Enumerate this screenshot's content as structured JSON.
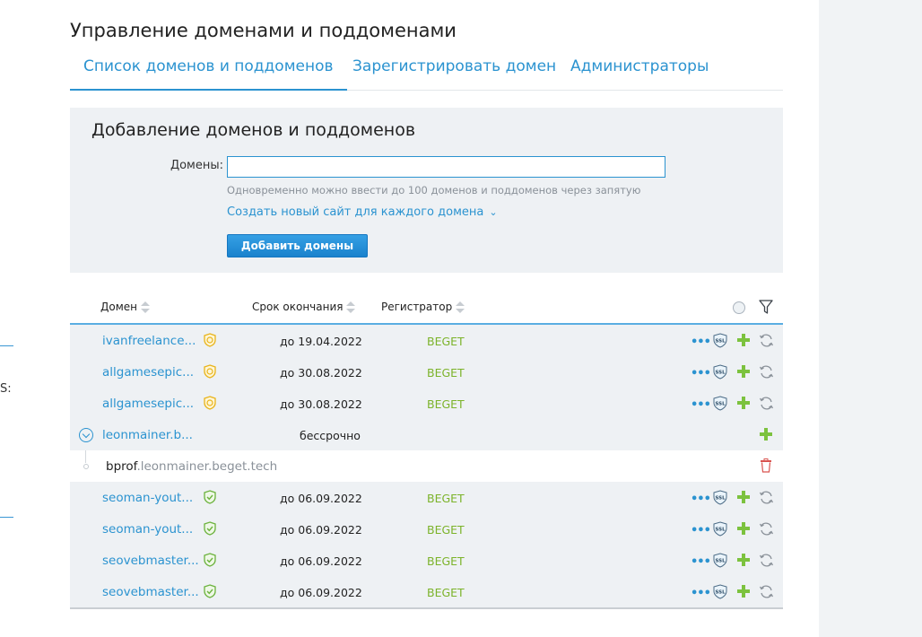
{
  "page": {
    "title": "Управление доменами и поддоменами",
    "left_edge_char": "S:"
  },
  "tabs": [
    {
      "label": "Список доменов и поддоменов",
      "active": true
    },
    {
      "label": "Зарегистрировать домен",
      "active": false
    },
    {
      "label": "Администраторы",
      "active": false
    }
  ],
  "add_form": {
    "title": "Добавление доменов и поддоменов",
    "domains_label": "Домены:",
    "domains_value": "",
    "hint": "Одновременно можно ввести до 100 доменов и поддоменов через запятую",
    "create_site_link": "Создать новый сайт для каждого домена",
    "submit_label": "Добавить домены"
  },
  "table": {
    "columns": {
      "domain": "Домен",
      "expiry": "Срок окончания",
      "registrar": "Регистратор"
    },
    "header_icons": [
      "globe-icon",
      "filter-icon"
    ],
    "rows": [
      {
        "domain": "ivanfreelance...",
        "badge": "yellow-sync-shield",
        "expiry": "до 19.04.2022",
        "registrar": "BEGET",
        "actions": [
          "more-dots-icon",
          "ssl-shield-icon",
          "add-plus-icon",
          "sync-icon"
        ]
      },
      {
        "domain": "allgamesepic...",
        "badge": "yellow-sync-shield",
        "expiry": "до 30.08.2022",
        "registrar": "BEGET",
        "actions": [
          "more-dots-icon",
          "ssl-shield-icon",
          "add-plus-icon",
          "sync-icon"
        ]
      },
      {
        "domain": "allgamesepic...",
        "badge": "yellow-sync-shield",
        "expiry": "до 30.08.2022",
        "registrar": "BEGET",
        "actions": [
          "more-dots-icon",
          "ssl-shield-icon",
          "add-plus-icon",
          "sync-icon"
        ]
      },
      {
        "domain": "leonmainer.b...",
        "expanded": true,
        "expiry": "бессрочно",
        "registrar": "",
        "actions": [
          "add-plus-icon"
        ]
      },
      {
        "subdomain_prefix": "bprof",
        "subdomain_suffix": ".leonmainer.beget.tech",
        "actions": [
          "trash-icon"
        ]
      },
      {
        "domain": "seoman-yout...",
        "badge": "green-check-shield",
        "expiry": "до 06.09.2022",
        "registrar": "BEGET",
        "actions": [
          "more-dots-icon",
          "ssl-shield-icon",
          "add-plus-icon",
          "sync-icon"
        ]
      },
      {
        "domain": "seoman-yout...",
        "badge": "green-check-shield",
        "expiry": "до 06.09.2022",
        "registrar": "BEGET",
        "actions": [
          "more-dots-icon",
          "ssl-shield-icon",
          "add-plus-icon",
          "sync-icon"
        ]
      },
      {
        "domain": "seovebmaster...",
        "badge": "green-check-shield",
        "expiry": "до 06.09.2022",
        "registrar": "BEGET",
        "actions": [
          "more-dots-icon",
          "ssl-shield-icon",
          "add-plus-icon",
          "sync-icon"
        ]
      },
      {
        "domain": "seovebmaster...",
        "badge": "green-check-shield",
        "expiry": "до 06.09.2022",
        "registrar": "BEGET",
        "actions": [
          "more-dots-icon",
          "ssl-shield-icon",
          "add-plus-icon",
          "sync-icon"
        ]
      }
    ]
  },
  "colors": {
    "accent": "#2b93d0",
    "registrar_green": "#7cb32a",
    "panel_bg": "#eef1f4",
    "badge_yellow": "#e8b41c",
    "badge_green": "#6db33f",
    "trash_red": "#d9534f"
  },
  "ssl_text": "SSL"
}
